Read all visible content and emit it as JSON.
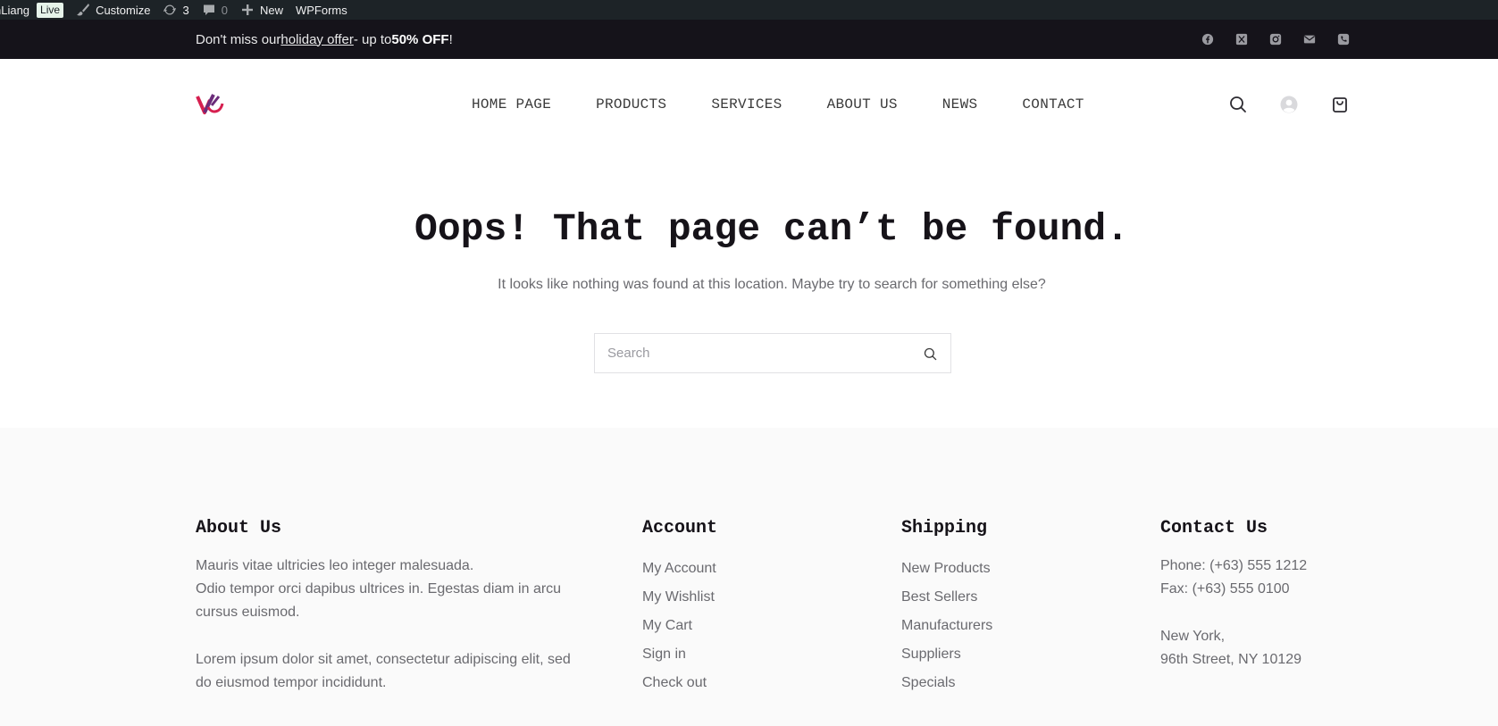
{
  "adminbar": {
    "site_name": "nLiang",
    "live_badge": "Live",
    "customize": "Customize",
    "updates_count": "3",
    "comments_count": "0",
    "new_label": "New",
    "wpforms": "WPForms"
  },
  "topbar": {
    "msg_prefix": "Don't miss our ",
    "msg_link": "holiday offer",
    "msg_middle": " - up to ",
    "msg_bold": "50% OFF",
    "msg_suffix": "!",
    "social": [
      "facebook-icon",
      "x-twitter-icon",
      "instagram-icon",
      "email-icon",
      "phone-icon"
    ]
  },
  "nav": {
    "items": [
      "HOME PAGE",
      "PRODUCTS",
      "SERVICES",
      "ABOUT US",
      "NEWS",
      "CONTACT"
    ]
  },
  "main": {
    "title": "Oops! That page can’t be found.",
    "subtitle": "It looks like nothing was found at this location. Maybe try to search for something else?",
    "search_placeholder": "Search"
  },
  "footer": {
    "about": {
      "heading": "About Us",
      "para1": "Mauris vitae ultricies leo integer malesuada.",
      "para2": "Odio tempor orci dapibus ultrices in. Egestas diam in arcu cursus euismod.",
      "para3": "Lorem ipsum dolor sit amet, consectetur adipiscing elit, sed do eiusmod tempor incididunt."
    },
    "account": {
      "heading": "Account",
      "links": [
        "My Account",
        "My Wishlist",
        "My Cart",
        "Sign in",
        "Check out"
      ]
    },
    "shipping": {
      "heading": "Shipping",
      "links": [
        "New Products",
        "Best Sellers",
        "Manufacturers",
        "Suppliers",
        "Specials"
      ]
    },
    "contact": {
      "heading": "Contact Us",
      "phone": "Phone: (+63) 555 1212",
      "fax": "Fax: (+63) 555 0100",
      "city": "New York,",
      "street": "96th Street, NY 10129"
    }
  },
  "colors": {
    "adminbar_bg": "#1d2327",
    "topbar_bg": "#15131a",
    "footer_bg": "#fafafa",
    "heading": "#161319",
    "logo_red": "#d61f4f",
    "logo_purple": "#6b2c7a"
  }
}
